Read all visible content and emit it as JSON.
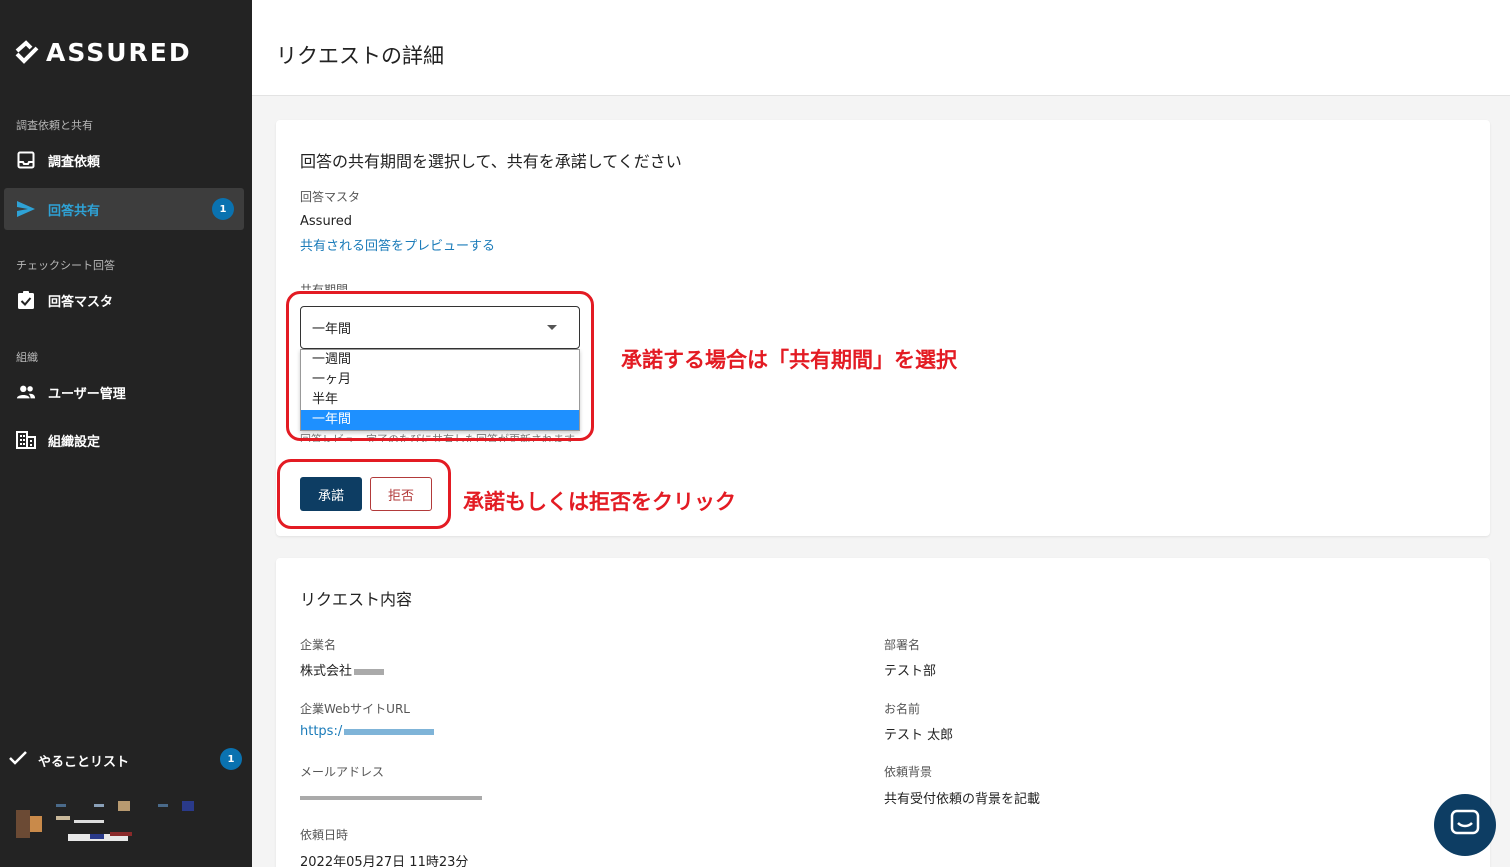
{
  "brand": {
    "name": "ASSURED"
  },
  "sidebar": {
    "sections": [
      {
        "label": "調査依頼と共有"
      },
      {
        "label": "チェックシート回答"
      },
      {
        "label": "組織"
      }
    ],
    "items": [
      {
        "label": "調査依頼",
        "icon": "inbox-icon"
      },
      {
        "label": "回答共有",
        "icon": "send-icon",
        "badge": "1"
      },
      {
        "label": "回答マスタ",
        "icon": "clipboard-check-icon"
      },
      {
        "label": "ユーザー管理",
        "icon": "users-icon"
      },
      {
        "label": "組織設定",
        "icon": "building-icon"
      }
    ],
    "todo": {
      "label": "やることリスト",
      "badge": "1"
    }
  },
  "header": {
    "title": "リクエストの詳細"
  },
  "share_card": {
    "title": "回答の共有期間を選択して、共有を承諾してください",
    "master_label": "回答マスタ",
    "master_value": "Assured",
    "preview_link": "共有される回答をプレビューする",
    "period_label": "共有期間",
    "period_selected": "一年間",
    "period_options": [
      "一週間",
      "一ヶ月",
      "半年",
      "一年間"
    ],
    "hint": "回答レビュー完了のたびに共有した回答が更新されます",
    "accept_label": "承諾",
    "reject_label": "拒否"
  },
  "annotations": {
    "select_note": "承諾する場合は「共有期間」を選択",
    "button_note": "承諾もしくは拒否をクリック"
  },
  "request_card": {
    "title": "リクエスト内容",
    "company_label": "企業名",
    "company_value": "株式会社",
    "dept_label": "部署名",
    "dept_value": "テスト部",
    "website_label": "企業WebサイトURL",
    "website_value": "https:/",
    "name_label": "お名前",
    "name_value": "テスト 太郎",
    "email_label": "メールアドレス",
    "background_label": "依頼背景",
    "background_value": "共有受付依頼の背景を記載",
    "date_label": "依頼日時",
    "date_value": "2022年05月27日 11時23分"
  },
  "colors": {
    "accent": "#0d3d63",
    "annotation": "#e31b23",
    "link": "#1a7bb9",
    "sidebar": "#232323"
  }
}
